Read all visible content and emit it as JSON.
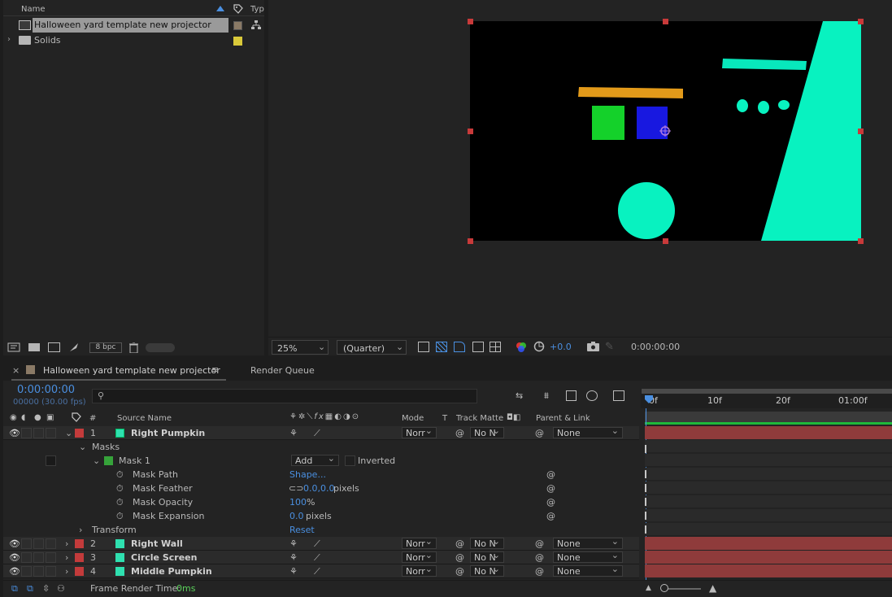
{
  "project": {
    "col_name": "Name",
    "col_type": "Typ",
    "items": [
      {
        "label": "Halloween yard template new projector",
        "chip": "#8a7a66",
        "selected": true
      },
      {
        "label": "Solids",
        "chip": "#d9c93a",
        "selected": false
      }
    ],
    "bpc": "8 bpc"
  },
  "viewer": {
    "zoom": "25%",
    "resolution": "(Quarter)",
    "exposure": "+0.0",
    "timecode": "0:00:00:00"
  },
  "tabs": {
    "comp": "Halloween yard template new projector",
    "render": "Render Queue",
    "close_glyph": "×",
    "menu_glyph": "≡"
  },
  "timeline": {
    "current_time": "0:00:00:00",
    "frames_fps": "00000 (30.00 fps)",
    "ruler": [
      "0f",
      "10f",
      "20f",
      "01:00f"
    ],
    "headers": {
      "num": "#",
      "source": "Source Name",
      "mode": "Mode",
      "t": "T",
      "track_matte": "Track Matte",
      "parent": "Parent & Link"
    },
    "layers": [
      {
        "num": "1",
        "name": "Right Pumpkin",
        "mode": "Norr",
        "matte": "No N",
        "parent": "None"
      },
      {
        "num": "2",
        "name": "Right Wall",
        "mode": "Norr",
        "matte": "No N",
        "parent": "None"
      },
      {
        "num": "3",
        "name": "Circle Screen",
        "mode": "Norr",
        "matte": "No N",
        "parent": "None"
      },
      {
        "num": "4",
        "name": "Middle Pumpkin",
        "mode": "Norr",
        "matte": "No N",
        "parent": "None"
      }
    ],
    "masks_label": "Masks",
    "mask1": {
      "label": "Mask 1",
      "mode": "Add",
      "inverted": "Inverted"
    },
    "mask_props": [
      {
        "label": "Mask Path",
        "value": "Shape...",
        "unit": ""
      },
      {
        "label": "Mask Feather",
        "value": "0.0,0.0",
        "unit": "pixels"
      },
      {
        "label": "Mask Opacity",
        "value": "100",
        "unit": "%"
      },
      {
        "label": "Mask Expansion",
        "value": "0.0",
        "unit": "pixels"
      }
    ],
    "transform": {
      "label": "Transform",
      "value": "Reset"
    },
    "frame_render_label": "Frame Render Time:",
    "frame_render_value": "0ms"
  },
  "colors": {
    "label_red": "#c33b3b",
    "layer_chip": "#2fe0b0",
    "mask_chip": "#36a33a",
    "accent_blue": "#4a8fe0"
  }
}
